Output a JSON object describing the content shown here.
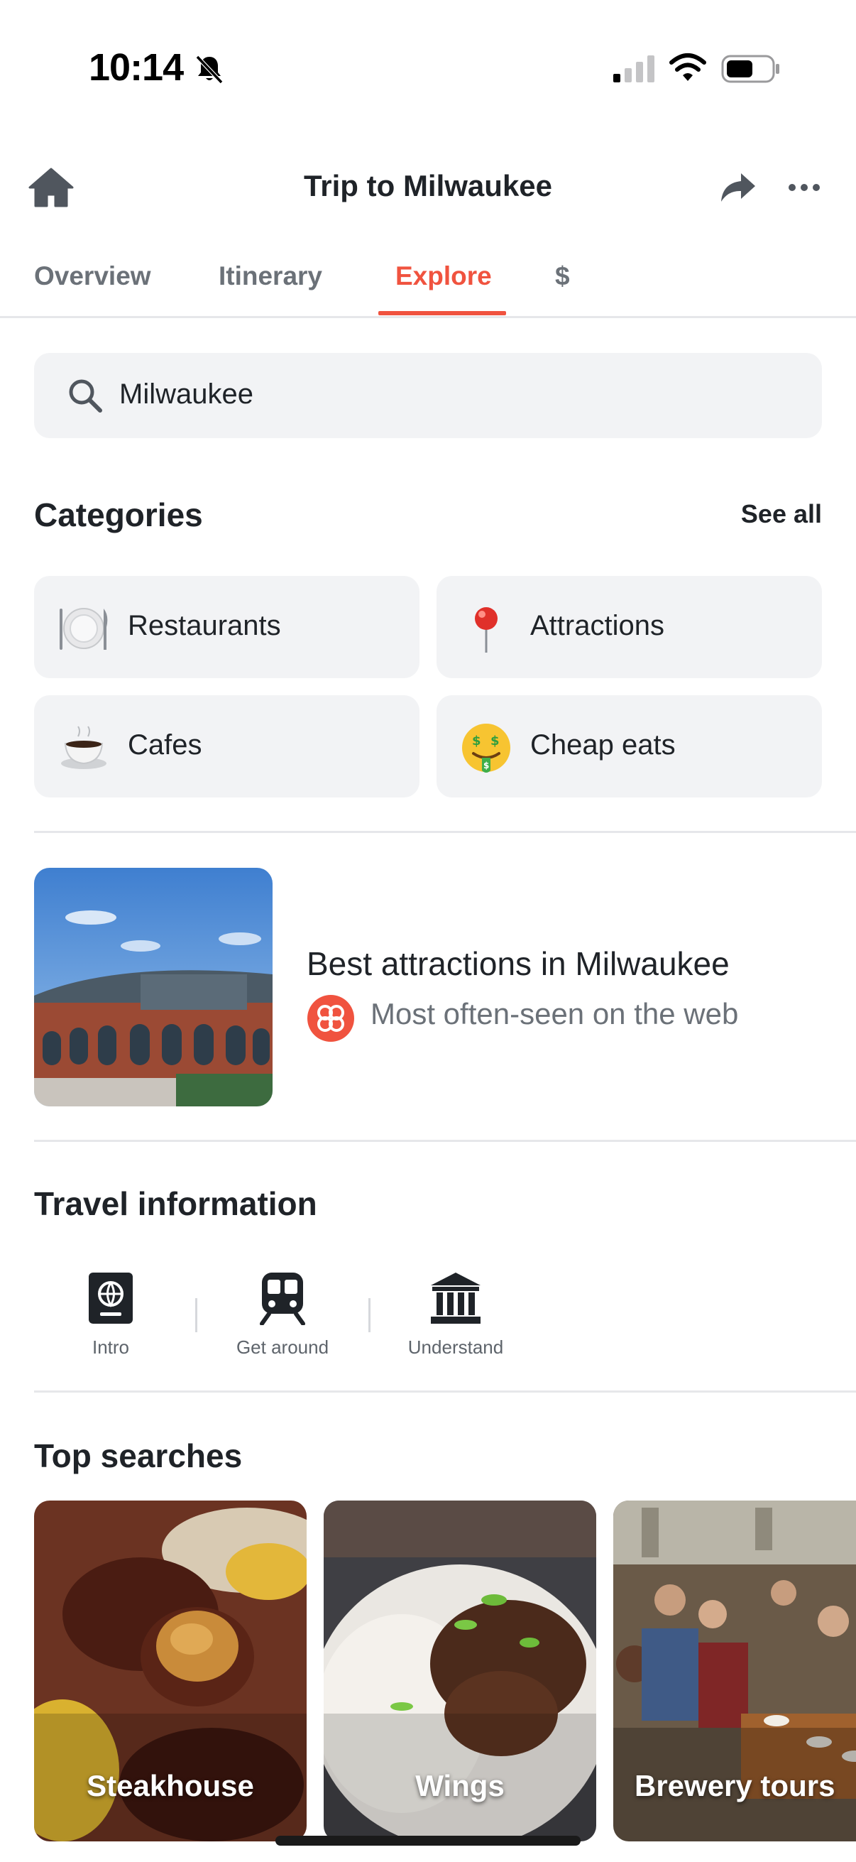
{
  "status_bar": {
    "time": "10:14",
    "icons": [
      "bell-slash-icon",
      "cellular-signal-icon",
      "wifi-icon",
      "battery-icon"
    ]
  },
  "header": {
    "title": "Trip to Milwaukee",
    "icons": [
      "home-icon",
      "share-icon",
      "more-icon"
    ]
  },
  "tabs": [
    {
      "label": "Overview",
      "active": false
    },
    {
      "label": "Itinerary",
      "active": false
    },
    {
      "label": "Explore",
      "active": true
    },
    {
      "label": "$",
      "active": false
    }
  ],
  "search": {
    "value": "Milwaukee",
    "icon": "search-icon"
  },
  "categories": {
    "title": "Categories",
    "see_all": "See all",
    "items": [
      {
        "label": "Restaurants",
        "icon": "plate-icon"
      },
      {
        "label": "Attractions",
        "icon": "pin-icon"
      },
      {
        "label": "Cafes",
        "icon": "coffee-icon"
      },
      {
        "label": "Cheap eats",
        "icon": "money-face-icon"
      }
    ]
  },
  "guide": {
    "title": "Best attractions in Milwaukee",
    "subtitle": "Most often-seen on the web",
    "source_icon": "web-source-icon"
  },
  "travel_info": {
    "title": "Travel information",
    "items": [
      {
        "label": "Intro",
        "icon": "passport-icon"
      },
      {
        "label": "Get around",
        "icon": "train-icon"
      },
      {
        "label": "Understand",
        "icon": "museum-icon"
      }
    ]
  },
  "top_searches": {
    "title": "Top searches",
    "items": [
      {
        "label": "Steakhouse"
      },
      {
        "label": "Wings"
      },
      {
        "label": "Brewery tours"
      }
    ]
  },
  "colors": {
    "accent": "#f0533f",
    "chip_bg": "#f2f3f5",
    "text": "#1f2328",
    "muted": "#6b7178"
  }
}
